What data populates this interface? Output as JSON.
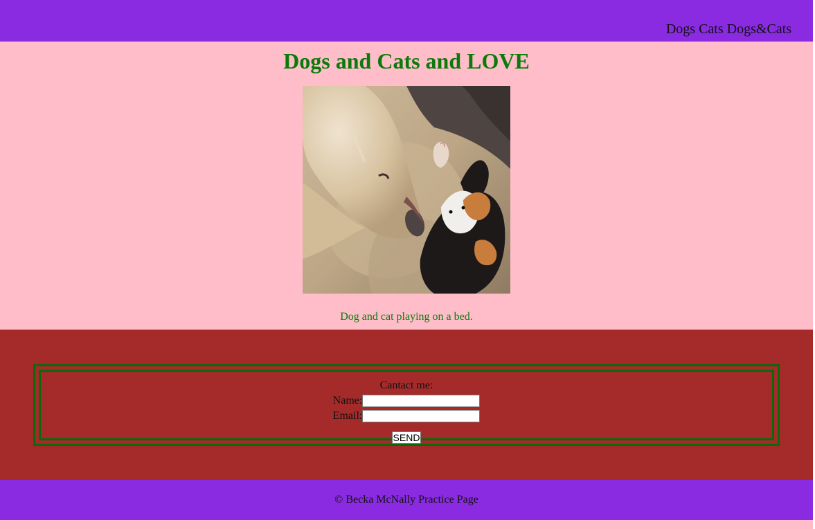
{
  "header": {
    "nav": [
      {
        "label": "Dogs"
      },
      {
        "label": "Cats"
      },
      {
        "label": "Dogs&Cats"
      }
    ]
  },
  "main": {
    "title": "Dogs and Cats and LOVE",
    "image": {
      "alt": "dog and cat",
      "icon": "photo-dog-cat"
    },
    "caption": "Dog and cat playing on a bed."
  },
  "contact": {
    "legend": "Cantact me:",
    "name_label": "Name:",
    "name_value": "",
    "email_label": "Email:",
    "email_value": "",
    "send_label": "SEND"
  },
  "footer": {
    "text": "© Becka McNally Practice Page"
  },
  "colors": {
    "header_bg": "#8a2be2",
    "page_bg": "#ffbdca",
    "contact_bg": "#a52a2a",
    "title_color": "#0a7b0a",
    "border_green": "#0a6a0a"
  }
}
